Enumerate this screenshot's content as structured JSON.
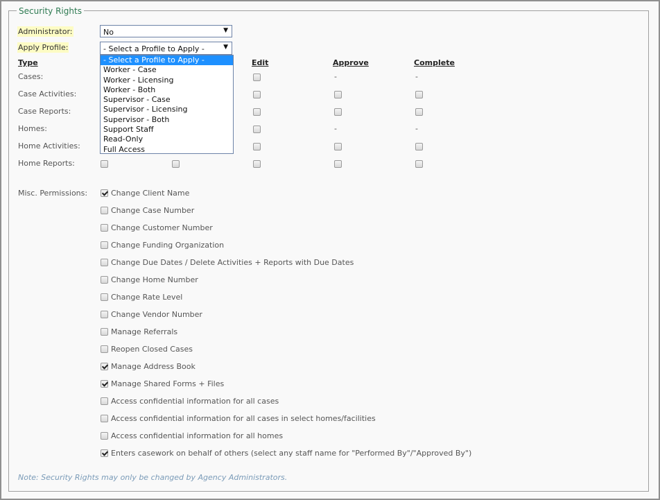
{
  "fieldset": {
    "legend": "Security Rights"
  },
  "administrator": {
    "label": "Administrator:",
    "value": "No"
  },
  "apply_profile": {
    "label": "Apply Profile:",
    "value": "- Select a Profile to Apply -",
    "options": [
      "- Select a Profile to Apply -",
      "Worker - Case",
      "Worker - Licensing",
      "Worker - Both",
      "Supervisor - Case",
      "Supervisor - Licensing",
      "Supervisor - Both",
      "Support Staff",
      "Read-Only",
      "Full Access"
    ]
  },
  "columns": {
    "type": "Type",
    "edit": "Edit",
    "approve": "Approve",
    "complete": "Complete"
  },
  "rows": [
    {
      "label": "Cases:",
      "approve": "-",
      "complete": "-"
    },
    {
      "label": "Case Activities:"
    },
    {
      "label": "Case Reports:"
    },
    {
      "label": "Homes:",
      "approve": "-",
      "complete": "-"
    },
    {
      "label": "Home Activities:"
    },
    {
      "label": "Home Reports:"
    }
  ],
  "misc": {
    "label": "Misc. Permissions:",
    "items": [
      {
        "text": "Change Client Name",
        "checked": true
      },
      {
        "text": "Change Case Number",
        "checked": false
      },
      {
        "text": "Change Customer Number",
        "checked": false
      },
      {
        "text": "Change Funding Organization",
        "checked": false
      },
      {
        "text": "Change Due Dates / Delete Activities + Reports with Due Dates",
        "checked": false
      },
      {
        "text": "Change Home Number",
        "checked": false
      },
      {
        "text": "Change Rate Level",
        "checked": false
      },
      {
        "text": "Change Vendor Number",
        "checked": false
      },
      {
        "text": "Manage Referrals",
        "checked": false
      },
      {
        "text": "Reopen Closed Cases",
        "checked": false
      },
      {
        "text": "Manage Address Book",
        "checked": true
      },
      {
        "text": "Manage Shared Forms + Files",
        "checked": true
      },
      {
        "text": "Access confidential information for all cases",
        "checked": false
      },
      {
        "text": "Access confidential information for all cases in select homes/facilities",
        "checked": false
      },
      {
        "text": "Access confidential information for all homes",
        "checked": false
      },
      {
        "text": "Enters casework on behalf of others (select any staff name for \"Performed By\"/\"Approved By\")",
        "checked": true
      }
    ]
  },
  "note": "Note: Security Rights may only be changed by Agency Administrators."
}
